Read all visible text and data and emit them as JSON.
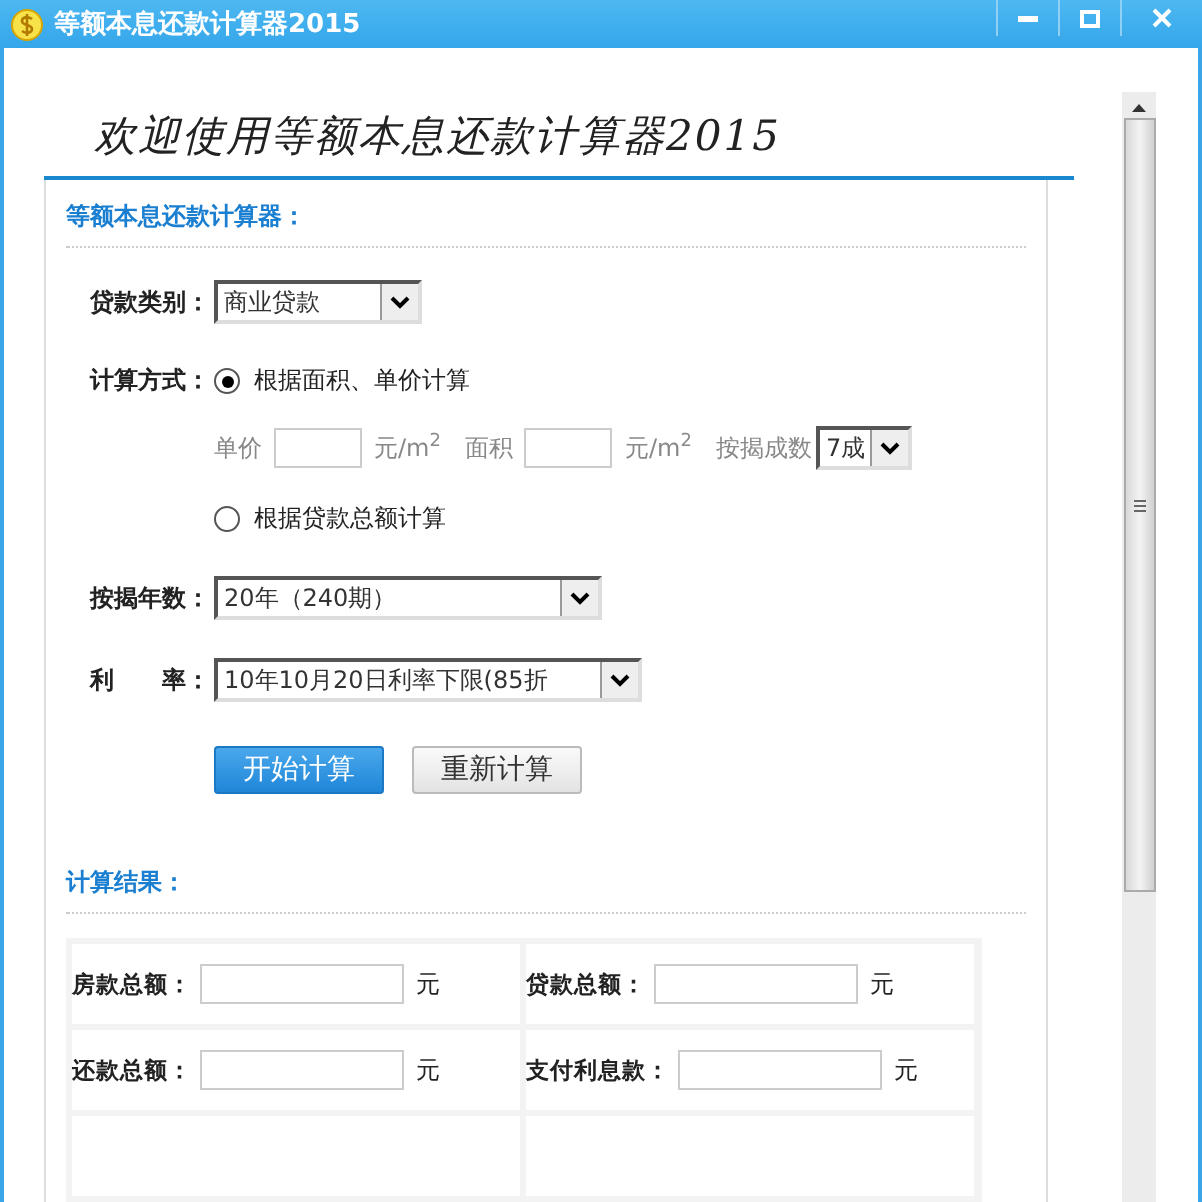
{
  "window": {
    "title": "等额本息还款计算器2015"
  },
  "banner": {
    "text": "欢迎使用等额本息还款计算器2015"
  },
  "form": {
    "heading": "等额本息还款计算器：",
    "loan_type": {
      "label": "贷款类别：",
      "value": "商业贷款"
    },
    "method": {
      "label": "计算方式：",
      "options": [
        {
          "label": "根据面积、单价计算",
          "selected": true
        },
        {
          "label": "根据贷款总额计算",
          "selected": false
        }
      ]
    },
    "price_row": {
      "disabled": false,
      "unit_price_label": "单价",
      "unit_price_unit": "元/m$^{2}$",
      "area_label": "面积",
      "area_unit": "元/m$^{2}$",
      "ratio_label": "按揭成数",
      "ratio_value": "7成"
    },
    "years": {
      "label": "按揭年数：",
      "value": "20年（240期）"
    },
    "rate": {
      "label": "利　　率：",
      "value": "10年10月20日利率下限(85折"
    },
    "buttons": [
      {
        "label": "开始计算",
        "kind": "primary"
      },
      {
        "label": "重新计算",
        "kind": "secondary"
      }
    ]
  },
  "results": {
    "heading": "计算结果：",
    "items": [
      {
        "label": "房款总额：",
        "unit": "元"
      },
      {
        "label": "贷款总额：",
        "unit": "元"
      },
      {
        "label": "还款总额：",
        "unit": "元"
      },
      {
        "label": "支付利息款：",
        "unit": "元"
      }
    ]
  }
}
